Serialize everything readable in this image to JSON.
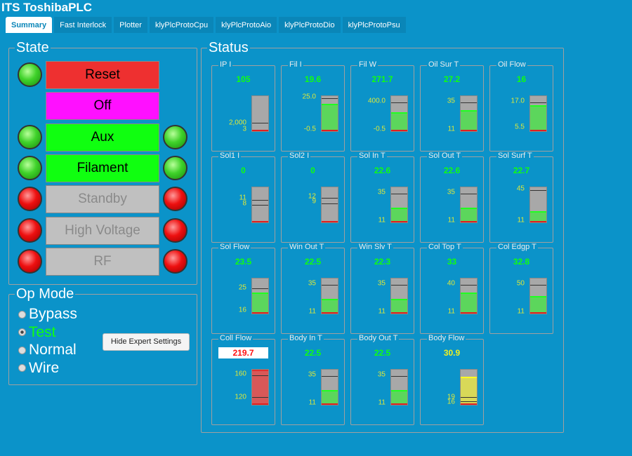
{
  "app": {
    "title": "ITS ToshibaPLC"
  },
  "tabs": [
    {
      "label": "Summary",
      "active": true
    },
    {
      "label": "Fast Interlock"
    },
    {
      "label": "Plotter"
    },
    {
      "label": "klyPlcProtoCpu"
    },
    {
      "label": "klyPlcProtoAio"
    },
    {
      "label": "klyPlcProtoDio"
    },
    {
      "label": "klyPlcProtoPsu"
    }
  ],
  "state": {
    "title": "State",
    "buttons": [
      {
        "label": "Reset",
        "bg": "#ee3030",
        "fg": "#000",
        "left": "g",
        "right": null
      },
      {
        "label": "Off",
        "bg": "#ff10ff",
        "fg": "#000",
        "left": null,
        "right": null
      },
      {
        "label": "Aux",
        "bg": "#10ff10",
        "fg": "#000",
        "left": "g",
        "right": "g"
      },
      {
        "label": "Filament",
        "bg": "#10ff10",
        "fg": "#000",
        "left": "g",
        "right": "g"
      },
      {
        "label": "Standby",
        "bg": "#c0c0c0",
        "fg": "#8a8a8a",
        "left": "r",
        "right": "r"
      },
      {
        "label": "High Voltage",
        "bg": "#c0c0c0",
        "fg": "#8a8a8a",
        "left": "r",
        "right": "r"
      },
      {
        "label": "RF",
        "bg": "#c0c0c0",
        "fg": "#8a8a8a",
        "left": "r",
        "right": "r"
      }
    ]
  },
  "op_mode": {
    "title": "Op Mode",
    "options": [
      {
        "label": "Bypass"
      },
      {
        "label": "Test",
        "selected": true
      },
      {
        "label": "Normal"
      },
      {
        "label": "Wire"
      }
    ],
    "hide_button": "Hide Expert Settings"
  },
  "status": {
    "title": "Status",
    "gauges": [
      {
        "label": "IP I",
        "value": "105",
        "color": "#10ff10",
        "hi": "2,000",
        "hi_lvl": 0.22,
        "lo": "3",
        "lo_lvl": 0.04,
        "fill": 0,
        "fillc": "#5cd65c",
        "marks": [
          0.22
        ]
      },
      {
        "label": "Fil I",
        "value": "19.6",
        "color": "#10ff10",
        "hi": "25.0",
        "hi_lvl": 0.92,
        "lo": "-0.5",
        "lo_lvl": 0.04,
        "fill": 0.78,
        "fillc": "#5cd65c",
        "marks": [
          0.92
        ]
      },
      {
        "label": "Fil W",
        "value": "271.7",
        "color": "#10ff10",
        "hi": "400.0",
        "hi_lvl": 0.8,
        "lo": "-0.5",
        "lo_lvl": 0.04,
        "fill": 0.55,
        "fillc": "#5cd65c",
        "marks": [
          0.8
        ]
      },
      {
        "label": "Oil Sur T",
        "value": "27.2",
        "color": "#10ff10",
        "hi": "35",
        "hi_lvl": 0.8,
        "lo": "11",
        "lo_lvl": 0.04,
        "fill": 0.6,
        "fillc": "#5cd65c",
        "marks": [
          0.8
        ]
      },
      {
        "label": "Oil Flow",
        "value": "16",
        "color": "#10ff10",
        "hi": "17.0",
        "hi_lvl": 0.8,
        "lo": "5.5",
        "lo_lvl": 0.1,
        "fill": 0.75,
        "fillc": "#5cd65c",
        "marks": [
          0.8
        ]
      },
      {
        "label": "Sol1 I",
        "value": "0",
        "color": "#10ff10",
        "hi": "11",
        "hi_lvl": 0.65,
        "lo": "8",
        "lo_lvl": 0.5,
        "fill": 0,
        "fillc": "#5cd65c",
        "marks": [
          0.62,
          0.48
        ]
      },
      {
        "label": "Sol2 I",
        "value": "0",
        "color": "#10ff10",
        "hi": "12",
        "hi_lvl": 0.7,
        "lo": "9",
        "lo_lvl": 0.55,
        "fill": 0,
        "fillc": "#5cd65c",
        "marks": [
          0.68,
          0.52
        ]
      },
      {
        "label": "Sol In T",
        "value": "22.6",
        "color": "#10ff10",
        "hi": "35",
        "hi_lvl": 0.8,
        "lo": "11",
        "lo_lvl": 0.04,
        "fill": 0.42,
        "fillc": "#5cd65c",
        "marks": [
          0.8
        ]
      },
      {
        "label": "Sol Out T",
        "value": "22.6",
        "color": "#10ff10",
        "hi": "35",
        "hi_lvl": 0.8,
        "lo": "11",
        "lo_lvl": 0.04,
        "fill": 0.42,
        "fillc": "#5cd65c",
        "marks": [
          0.8
        ]
      },
      {
        "label": "Sol Surf T",
        "value": "22.7",
        "color": "#10ff10",
        "hi": "45",
        "hi_lvl": 0.9,
        "lo": "11",
        "lo_lvl": 0.04,
        "fill": 0.32,
        "fillc": "#5cd65c",
        "marks": [
          0.9
        ]
      },
      {
        "label": "Sol Flow",
        "value": "23.5",
        "color": "#10ff10",
        "hi": "25",
        "hi_lvl": 0.7,
        "lo": "16",
        "lo_lvl": 0.08,
        "fill": 0.6,
        "fillc": "#5cd65c",
        "marks": [
          0.7
        ]
      },
      {
        "label": "Win Out T",
        "value": "22.5",
        "color": "#10ff10",
        "hi": "35",
        "hi_lvl": 0.8,
        "lo": "11",
        "lo_lvl": 0.04,
        "fill": 0.42,
        "fillc": "#5cd65c",
        "marks": [
          0.8
        ]
      },
      {
        "label": "Win Slv T",
        "value": "22.3",
        "color": "#10ff10",
        "hi": "35",
        "hi_lvl": 0.8,
        "lo": "11",
        "lo_lvl": 0.04,
        "fill": 0.42,
        "fillc": "#5cd65c",
        "marks": [
          0.8
        ]
      },
      {
        "label": "Col Top T",
        "value": "33",
        "color": "#10ff10",
        "hi": "40",
        "hi_lvl": 0.8,
        "lo": "11",
        "lo_lvl": 0.04,
        "fill": 0.6,
        "fillc": "#5cd65c",
        "marks": [
          0.8
        ]
      },
      {
        "label": "Col Edgp T",
        "value": "32.8",
        "color": "#10ff10",
        "hi": "50",
        "hi_lvl": 0.8,
        "lo": "11",
        "lo_lvl": 0.04,
        "fill": 0.5,
        "fillc": "#5cd65c",
        "marks": [
          0.8
        ]
      },
      {
        "label": "Coll Flow",
        "value": "219.7",
        "color": "#ff1010",
        "boxed": true,
        "hi": "160",
        "hi_lvl": 0.82,
        "lo": "120",
        "lo_lvl": 0.2,
        "fill": 1,
        "fillc": "#d85858",
        "marks": [
          0.82,
          0.2
        ]
      },
      {
        "label": "Body In T",
        "value": "22.5",
        "color": "#10ff10",
        "hi": "35",
        "hi_lvl": 0.8,
        "lo": "11",
        "lo_lvl": 0.04,
        "fill": 0.42,
        "fillc": "#5cd65c",
        "marks": [
          0.8
        ]
      },
      {
        "label": "Body Out T",
        "value": "22.5",
        "color": "#10ff10",
        "hi": "35",
        "hi_lvl": 0.8,
        "lo": "11",
        "lo_lvl": 0.04,
        "fill": 0.42,
        "fillc": "#5cd65c",
        "marks": [
          0.8
        ]
      },
      {
        "label": "Body Flow",
        "value": "30.9",
        "color": "#f0f020",
        "hi": "19",
        "hi_lvl": 0.2,
        "lo": "16",
        "lo_lvl": 0.06,
        "fill": 0.8,
        "fillc": "#d8d858",
        "marks": [
          0.2,
          0.08
        ]
      }
    ]
  }
}
